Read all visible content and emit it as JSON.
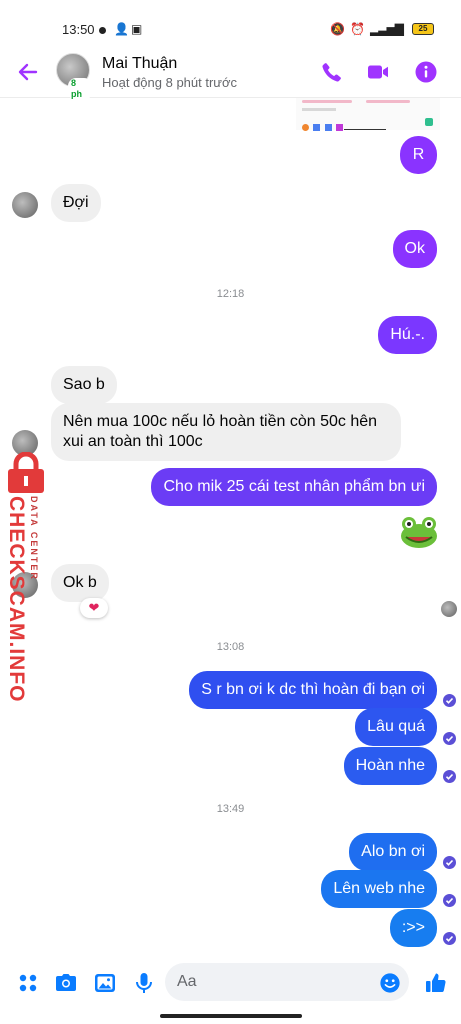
{
  "status_bar": {
    "time": "13:50",
    "battery": "25"
  },
  "header": {
    "contact_name": "Mai Thuận",
    "presence_badge": "8 ph",
    "contact_status": "Hoạt động 8 phút trước",
    "accent_color": "#a033ff"
  },
  "messages": [
    {
      "id": "r",
      "direction": "out",
      "text": "R",
      "color": "#8a33ff"
    },
    {
      "id": "doi",
      "direction": "in",
      "text": "Đợi"
    },
    {
      "id": "ok1",
      "direction": "out",
      "text": "Ok",
      "color": "#8a33ff"
    },
    {
      "id": "ts1",
      "type": "timestamp",
      "text": "12:18"
    },
    {
      "id": "hu",
      "direction": "out",
      "text": "Hú.-.",
      "color": "#7b37ff"
    },
    {
      "id": "saob",
      "direction": "in",
      "text": "Sao b"
    },
    {
      "id": "nenmua",
      "direction": "in",
      "lines": [
        "Nên mua 100c nếu lỏ hoàn tiền còn 50c hên",
        "xui an toàn thì 100c"
      ]
    },
    {
      "id": "chomik",
      "direction": "out",
      "text": "Cho mik 25 cái test nhân phẩm bn ưi",
      "color": "#6b3cf5"
    },
    {
      "id": "frog",
      "direction": "out",
      "type": "emoji",
      "text": "frog-emoji"
    },
    {
      "id": "okb",
      "direction": "in",
      "text": "Ok b",
      "reaction": "heart"
    },
    {
      "id": "ts2",
      "type": "timestamp",
      "text": "13:08"
    },
    {
      "id": "sr",
      "direction": "out",
      "text": "S r bn ơi k dc thì hoàn đi bạn ơi",
      "color": "#2f4ff0"
    },
    {
      "id": "lauqua",
      "direction": "out",
      "text": "Lâu quá",
      "color": "#2d56f0"
    },
    {
      "id": "hoan",
      "direction": "out",
      "text": "Hoàn nhe",
      "color": "#2b5cf0"
    },
    {
      "id": "ts3",
      "type": "timestamp",
      "text": "13:49"
    },
    {
      "id": "alo",
      "direction": "out",
      "text": "Alo bn ơi",
      "color": "#1f6ef0"
    },
    {
      "id": "lenweb",
      "direction": "out",
      "text": "Lên web nhe",
      "color": "#1b76f0"
    },
    {
      "id": "smile",
      "direction": "out",
      "text": ":>>",
      "color": "#177df0"
    }
  ],
  "watermark": {
    "text": "CHECKSCAM.INFO",
    "subtext": "DATA CENTER"
  },
  "composer": {
    "placeholder": "Aa",
    "accent_color": "#0a7cff"
  }
}
